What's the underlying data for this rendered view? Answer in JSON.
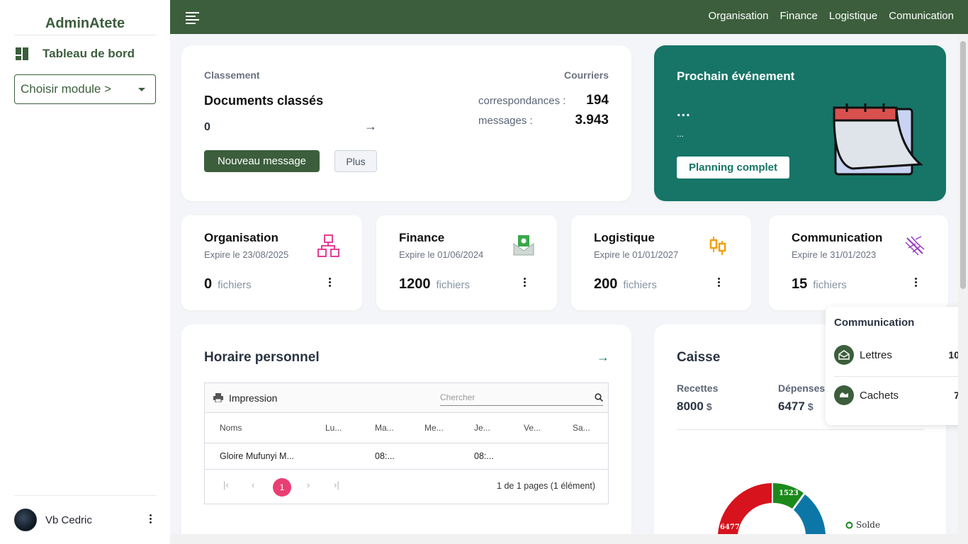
{
  "sidebar": {
    "brand": "AdminAtete",
    "dashboard_label": "Tableau de bord",
    "module_select": "Choisir module >",
    "user_name": "Vb Cedric"
  },
  "topbar": {
    "links": [
      "Organisation",
      "Finance",
      "Logistique",
      "Comunication"
    ]
  },
  "classement": {
    "section": "Classement",
    "title": "Documents classés",
    "count": "0",
    "new_message": "Nouveau message",
    "more": "Plus",
    "courriers_label": "Courriers",
    "correspondances_label": "correspondances :",
    "correspondances_value": "194",
    "messages_label": "messages :",
    "messages_value": "3.943"
  },
  "event": {
    "title": "Prochain événement",
    "name": "...",
    "detail": "...",
    "button": "Planning complet"
  },
  "modules": [
    {
      "title": "Organisation",
      "expiry": "Expire le 23/08/2025",
      "count": "0",
      "unit": "fichiers"
    },
    {
      "title": "Finance",
      "expiry": "Expire le 01/06/2024",
      "count": "1200",
      "unit": "fichiers"
    },
    {
      "title": "Logistique",
      "expiry": "Expire le 01/01/2027",
      "count": "200",
      "unit": "fichiers"
    },
    {
      "title": "Communication",
      "expiry": "Expire le 31/01/2023",
      "count": "15",
      "unit": "fichiers"
    }
  ],
  "schedule": {
    "title": "Horaire personnel",
    "print_label": "Impression",
    "search_placeholder": "Chercher",
    "columns": [
      "Noms",
      "Lu...",
      "Ma...",
      "Me...",
      "Je...",
      "Ve...",
      "Sa..."
    ],
    "rows": [
      {
        "name": "Gloire Mufunyi M...",
        "lu": "",
        "ma": "08:...",
        "me": "",
        "je": "08:...",
        "ve": "",
        "sa": ""
      }
    ],
    "current_page": "1",
    "pager_info": "1 de 1 pages (1 élément)"
  },
  "caisse": {
    "title": "Caisse",
    "recettes_label": "Recettes",
    "recettes_value": "8000",
    "depenses_label": "Dépenses",
    "depenses_value": "6477",
    "currency": "$",
    "chart_labels": {
      "red": "6477",
      "green": "1523",
      "legend": "Solde"
    }
  },
  "popover": {
    "title": "Communication",
    "items": [
      {
        "label": "Lettres",
        "count": "10"
      },
      {
        "label": "Cachets",
        "count": "7"
      }
    ]
  },
  "chart_data": {
    "type": "pie",
    "title": "",
    "categories": [
      "Dépenses",
      "Solde",
      ""
    ],
    "values": [
      6477,
      1523,
      null
    ],
    "legend": [
      "Solde"
    ]
  },
  "colors": {
    "brand_green": "#3c5e3c",
    "teal": "#167567",
    "pink": "#e83e74",
    "chart_red": "#d7131d",
    "chart_green": "#1b8a1b",
    "chart_blue": "#0c77a6"
  }
}
